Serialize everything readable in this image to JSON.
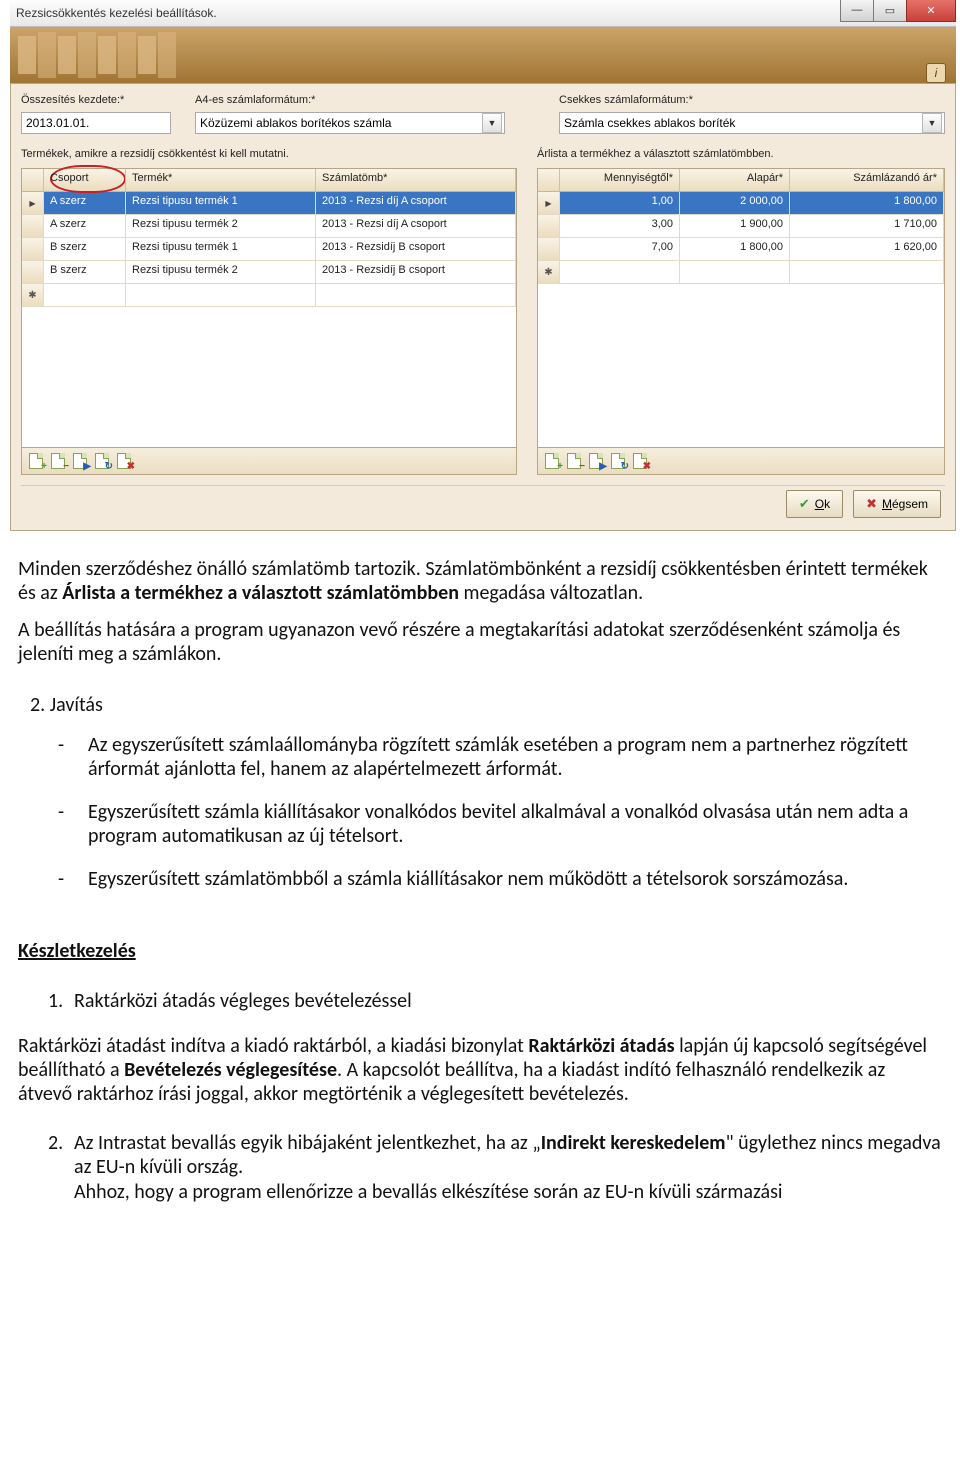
{
  "window": {
    "title": "Rezsicsökkentés kezelési beállítások."
  },
  "top_fields": {
    "start_label": "Összesítés kezdete:*",
    "start_value": "2013.01.01.",
    "a4_label": "A4-es számlaformátum:*",
    "a4_value": "Közüzemi ablakos borítékos számla",
    "chk_label": "Csekkes számlaformátum:*",
    "chk_value": "Számla csekkes ablakos boríték"
  },
  "left_panel": {
    "caption": "Termékek, amikre a rezsidíj csökkentést ki kell mutatni.",
    "cols": {
      "c1": "Csoport",
      "c2": "Termék*",
      "c3": "Számlatömb*"
    },
    "rows": [
      {
        "c1": "A szerz",
        "c2": "Rezsi tipusu termék 1",
        "c3": "2013 - Rezsi díj A csoport"
      },
      {
        "c1": "A szerz",
        "c2": "Rezsi tipusu termék 2",
        "c3": "2013 - Rezsi díj A csoport"
      },
      {
        "c1": "B szerz",
        "c2": "Rezsi tipusu termék 1",
        "c3": "2013 - Rezsidíj B csoport"
      },
      {
        "c1": "B szerz",
        "c2": "Rezsi tipusu termék 2",
        "c3": "2013 - Rezsidíj B csoport"
      }
    ]
  },
  "right_panel": {
    "caption": "Árlista a termékhez a választott számlatömbben.",
    "cols": {
      "c1": "Mennyiségtől*",
      "c2": "Alapár*",
      "c3": "Számlázandó ár*"
    },
    "rows": [
      {
        "c1": "1,00",
        "c2": "2 000,00",
        "c3": "1 800,00"
      },
      {
        "c1": "3,00",
        "c2": "1 900,00",
        "c3": "1 710,00"
      },
      {
        "c1": "7,00",
        "c2": "1 800,00",
        "c3": "1 620,00"
      }
    ]
  },
  "buttons": {
    "ok": "Ok",
    "cancel": "Mégsem"
  },
  "doc": {
    "p1a": "Minden szerződéshez önálló számlatömb tartozik. Számlatömbönként a rezsidíj csökkentésben érintett termékek és az ",
    "p1b": "Árlista a termékhez a választott számlatömbben",
    "p1c": " megadása változatlan.",
    "p2": "A beállítás hatására a program ugyanazon vevő részére a megtakarítási adatokat szerződésenként számolja és jeleníti meg a számlákon.",
    "n2": "2.  Javítás",
    "b1": "Az egyszerűsített számlaállományba rögzített számlák esetében a program nem a partnerhez rögzített árformát ajánlotta fel, hanem az alapértelmezett árformát.",
    "b2": "Egyszerűsített számla kiállításakor vonalkódos bevitel alkalmával a vonalkód olvasása után nem adta a program automatikusan az új tételsort.",
    "b3": "Egyszerűsített számlatömbből a számla kiállításakor nem működött a tételsorok sorszámozása.",
    "sec": "Készletkezelés",
    "k1": "Raktárközi átadás végleges bevételezéssel",
    "kp_a": "Raktárközi átadást indítva a kiadó raktárból, a kiadási bizonylat ",
    "kp_b": "Raktárközi átadás",
    "kp_c": " lapján új kapcsoló segítségével beállítható a ",
    "kp_d": "Bevételezés véglegesítése",
    "kp_e": ". A kapcsolót beállítva, ha a kiadást indító felhasználó rendelkezik az átvevő raktárhoz írási joggal, akkor megtörténik a véglegesített bevételezés.",
    "k2_a": "Az Intrastat bevallás egyik hibájaként jelentkezhet, ha az „",
    "k2_b": "Indirekt kereskedelem",
    "k2_c": "\" ügylethez nincs megadva az EU-n kívüli ország.",
    "k2_d": "Ahhoz, hogy a program ellenőrizze a bevallás elkészítése során az EU-n kívüli származási"
  }
}
